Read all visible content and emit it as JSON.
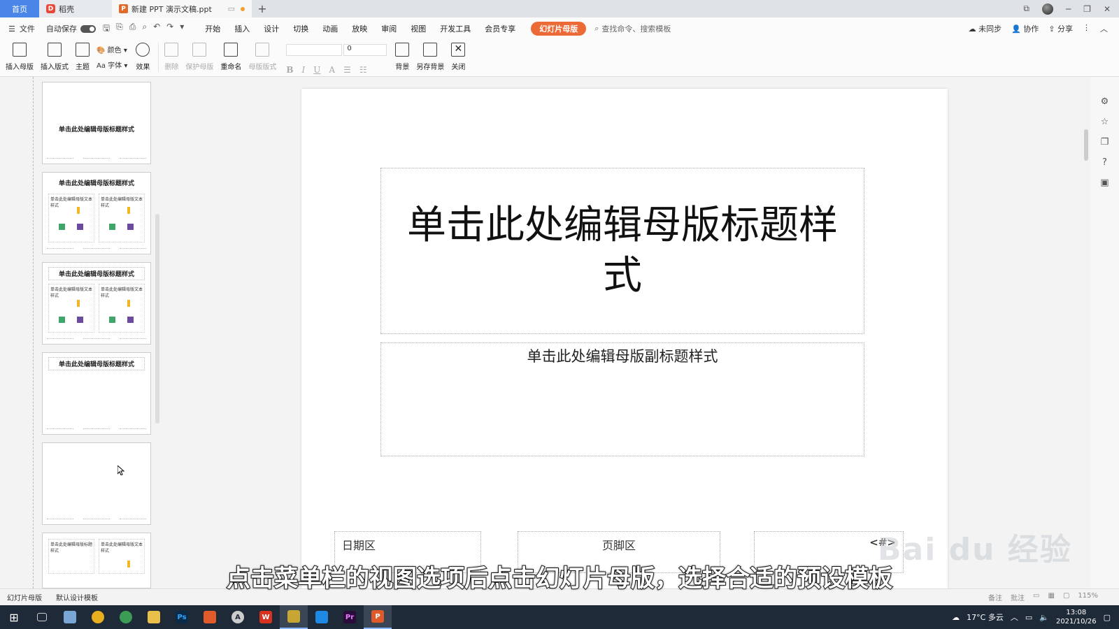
{
  "tabs": {
    "home": "首页",
    "daoke": "稻壳",
    "doc": "新建 PPT 演示文稿.ppt"
  },
  "menubar": {
    "file": "文件",
    "autosave": "自动保存",
    "items": [
      "开始",
      "插入",
      "设计",
      "切换",
      "动画",
      "放映",
      "审阅",
      "视图",
      "开发工具",
      "会员专享"
    ],
    "active": "幻灯片母版",
    "search": "查找命令、搜索模板",
    "right": [
      "未同步",
      "协作",
      "分享"
    ]
  },
  "ribbon": {
    "insert_master": "插入母版",
    "insert_layout": "插入版式",
    "theme": "主题",
    "color": "颜色",
    "font": "Aa 字体",
    "effect": "效果",
    "delete": "删除",
    "protect_master": "保护母版",
    "rename": "重命名",
    "master_layout": "母版版式",
    "font_size": "0",
    "background": "背景",
    "save_background": "另存背景",
    "close": "关闭"
  },
  "thumbnails": {
    "title": "单击此处编辑母版标题样式",
    "text_style": "单击此处编辑母版文本样式"
  },
  "slide": {
    "title": "单击此处编辑母版标题样式",
    "subtitle": "单击此处编辑母版副标题样式",
    "date": "日期区",
    "footer": "页脚区",
    "number": "<#>"
  },
  "caption": "点击菜单栏的视图选项后点击幻灯片母版，选择合适的预设模板",
  "watermark": "Bai du 经验",
  "statusbar": {
    "left": [
      "幻灯片母版",
      "默认设计模板"
    ],
    "right": [
      "备注",
      "批注",
      "115%"
    ]
  },
  "taskbar": {
    "weather": "17°C 多云",
    "time": "13:08",
    "date": "2021/10/26"
  },
  "colors": {
    "accent": "#ec6a35",
    "home_tab": "#4a86e8",
    "taskbar": "#1f2a38"
  }
}
